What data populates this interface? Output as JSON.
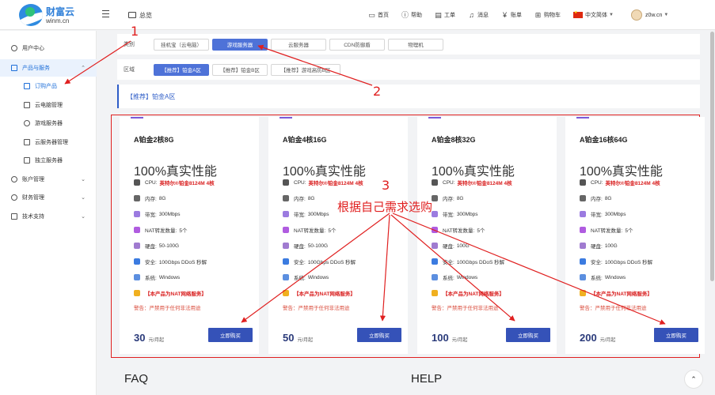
{
  "header": {
    "brand_name": "财富云",
    "brand_domain": "winm.cn",
    "overview": "总览",
    "nav": [
      {
        "label": "首页",
        "icon": "monitor-icon"
      },
      {
        "label": "帮助",
        "icon": "help-icon"
      },
      {
        "label": "工单",
        "icon": "ticket-icon"
      },
      {
        "label": "消息",
        "icon": "bell-icon"
      },
      {
        "label": "账单",
        "icon": "yuan-icon"
      },
      {
        "label": "购物车",
        "icon": "cart-icon"
      }
    ],
    "language": "中文简体",
    "user": "z0w.cn"
  },
  "sidebar": {
    "items": [
      {
        "label": "用户中心"
      },
      {
        "label": "产品与服务"
      },
      {
        "label": "订购产品"
      },
      {
        "label": "云电脑管理"
      },
      {
        "label": "游戏服务器"
      },
      {
        "label": "云服务器管理"
      },
      {
        "label": "独立服务器"
      },
      {
        "label": "账户管理"
      },
      {
        "label": "财务管理"
      },
      {
        "label": "技术支持"
      }
    ]
  },
  "filters": {
    "category_label": "类别",
    "categories": [
      "挂机宝（云电脑）",
      "游戏服务器",
      "云服务器",
      "CDN防御盾",
      "物理机"
    ],
    "region_label": "区域",
    "regions": [
      "【推荐】铂金A区",
      "【推荐】铂金B区",
      "【推荐】游戏高防B区"
    ]
  },
  "section_title": "【推荐】铂金A区",
  "labels": {
    "perf": "100%真实性能",
    "cpu_k": "CPU:",
    "cpu_v": "英特尔®铂金8124M 4核",
    "mem_k": "内存:",
    "bw_k": "带宽:",
    "bw_v": "300Mbps",
    "nat_k": "NAT转发数量:",
    "nat_v": "5个",
    "disk_k": "硬盘:",
    "sec_k": "安全:",
    "sec_v": "100Gbps DDoS 秒解",
    "os_k": "系统:",
    "os_v": "Windows",
    "notice": "【本产品为NAT网络服务】",
    "warn": "警告：严禁用于任何非法用途",
    "unit": "元/月起",
    "buy": "立即购买"
  },
  "cards": [
    {
      "name": "A铂金2核8G",
      "mem": "8G",
      "disk": "50-100G",
      "price": "30"
    },
    {
      "name": "A铂金4核16G",
      "mem": "8G",
      "disk": "50-100G",
      "price": "50"
    },
    {
      "name": "A铂金8核32G",
      "mem": "8G",
      "disk": "100G",
      "price": "100"
    },
    {
      "name": "A铂金16核64G",
      "mem": "8G",
      "disk": "100G",
      "price": "200"
    }
  ],
  "footer": {
    "faq": "FAQ",
    "help": "HELP"
  },
  "annotations": {
    "n1": "1",
    "n2": "2",
    "n3": "3",
    "note3": "根据自己需求选购",
    "color": "#e02020"
  },
  "colors": {
    "accent": "#4e72d8",
    "buy_button": "#3552b8",
    "warning": "#d91f1f"
  }
}
